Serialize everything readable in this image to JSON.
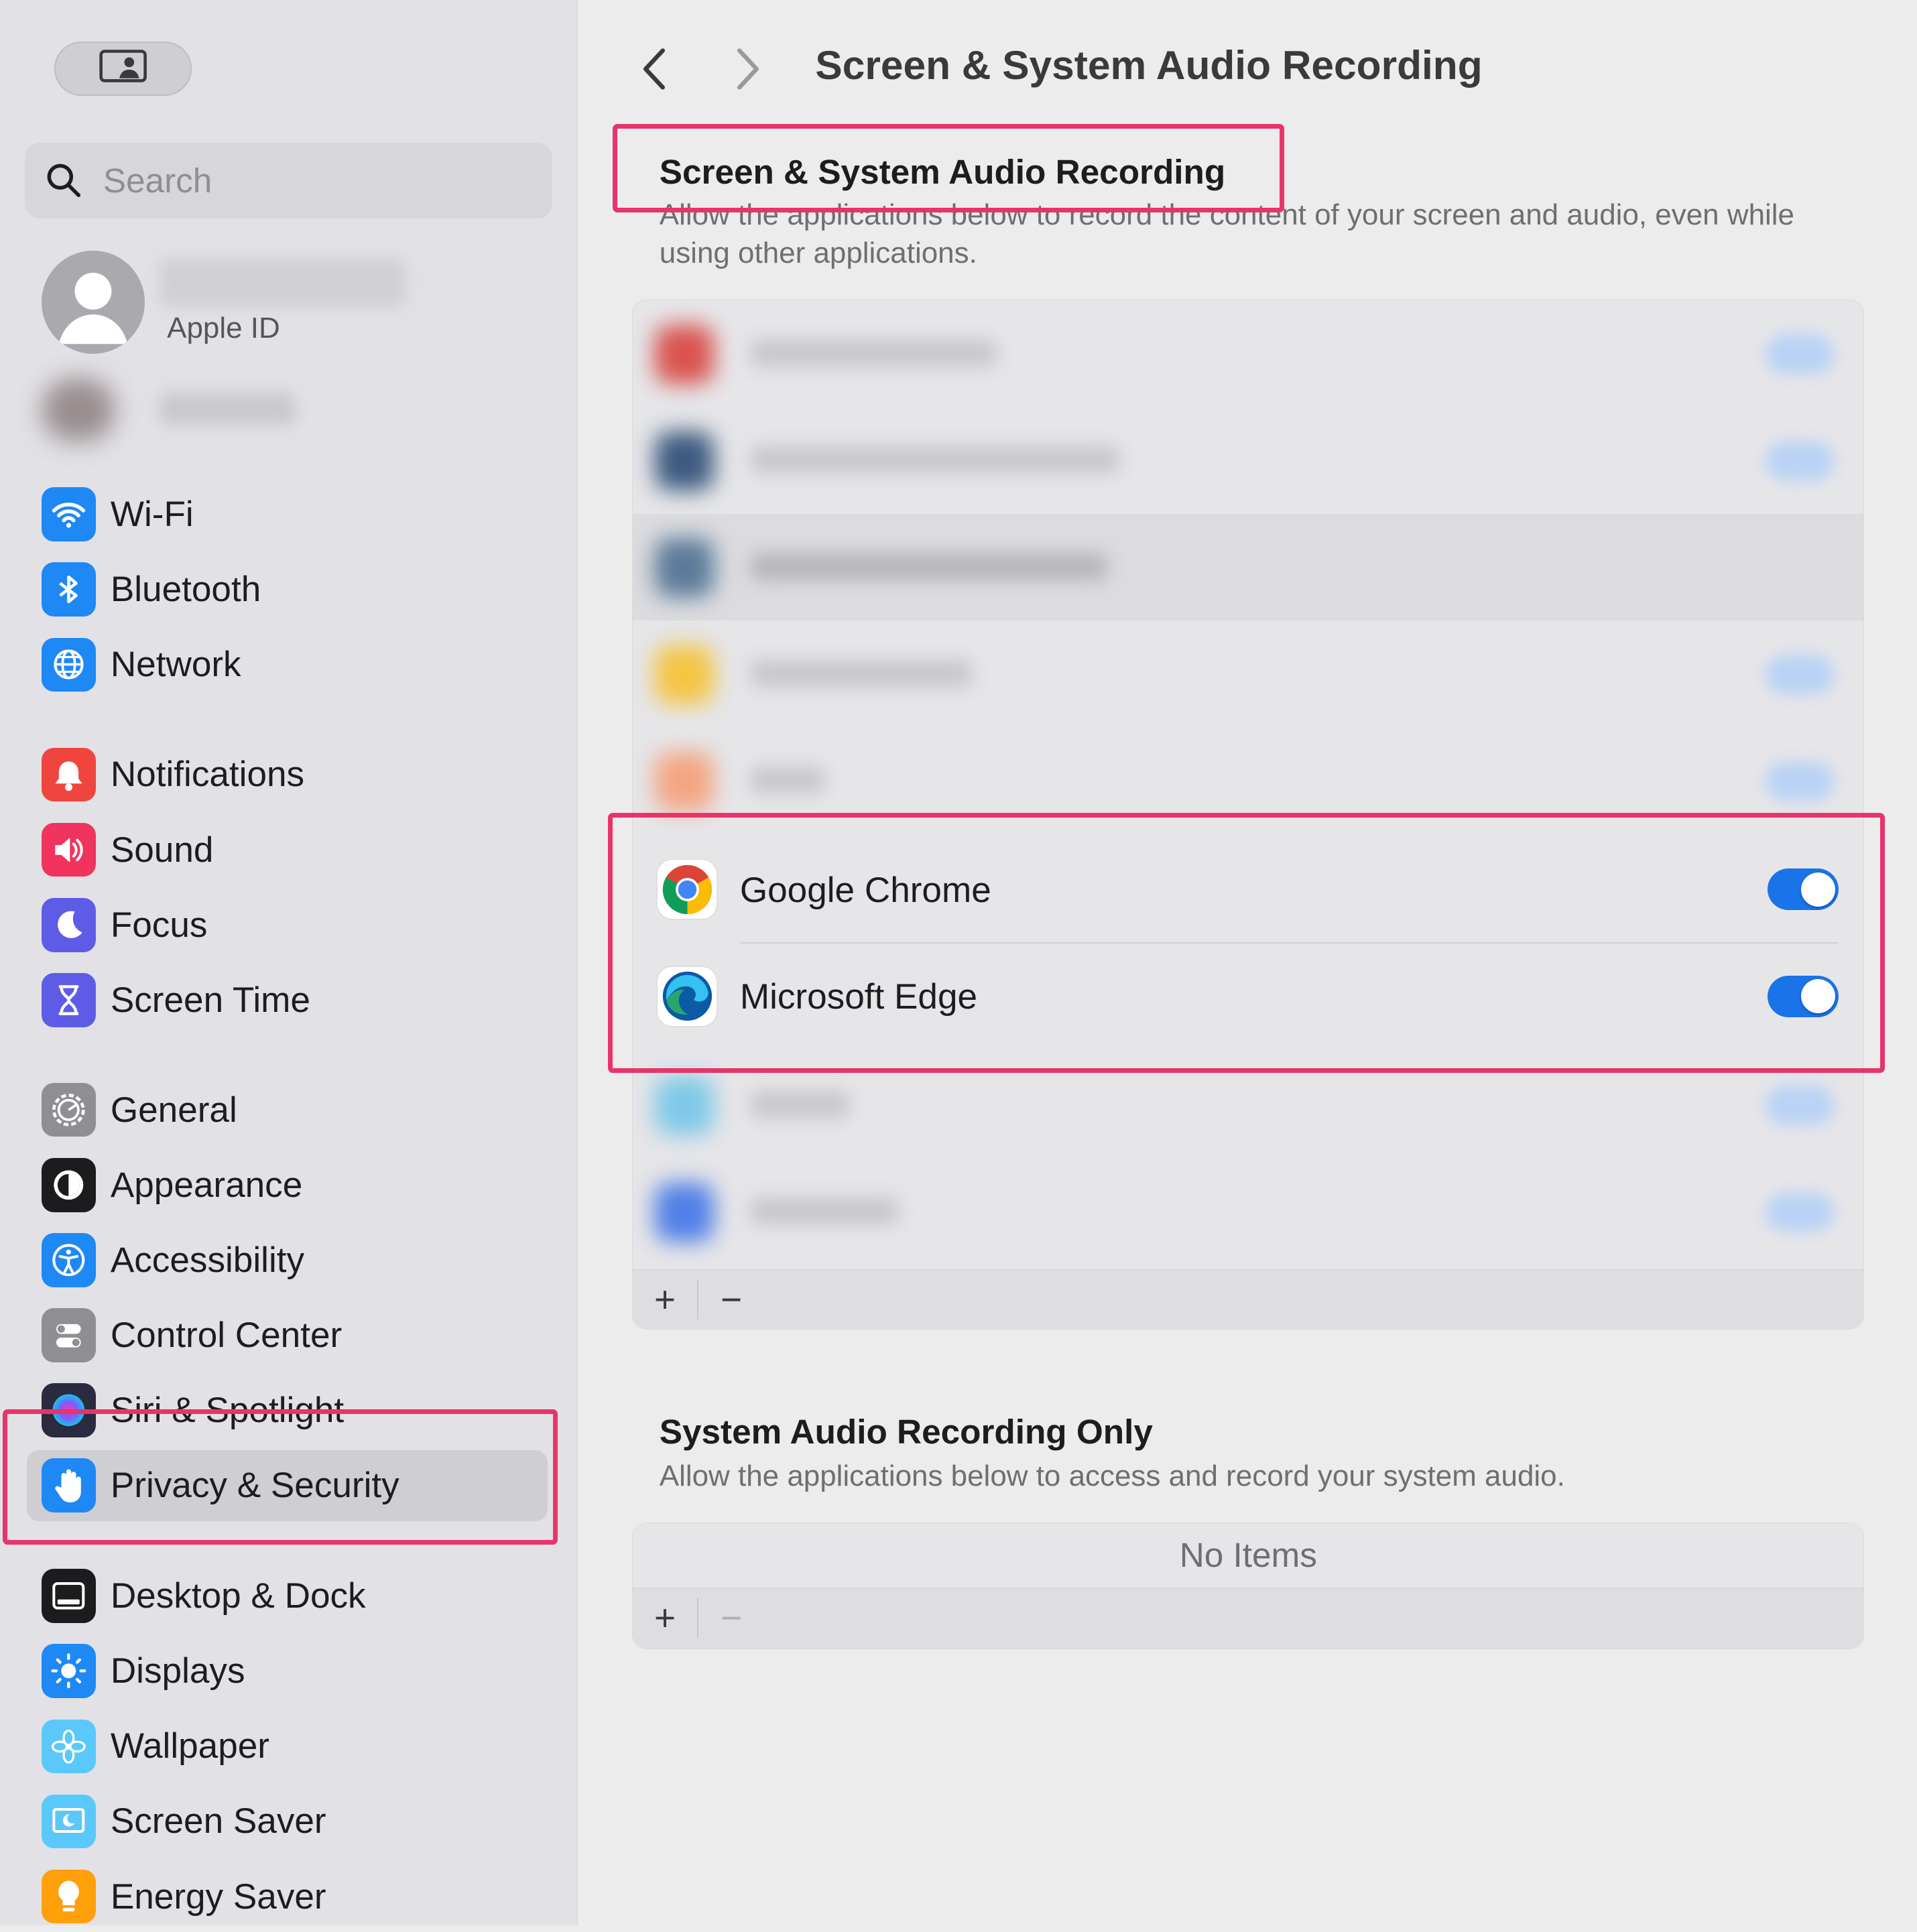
{
  "sidebar": {
    "search_placeholder": "Search",
    "account_label": "Apple ID",
    "groups": [
      [
        {
          "label": "Wi-Fi",
          "icon": "wifi-icon",
          "color": "#1E88F5"
        },
        {
          "label": "Bluetooth",
          "icon": "bluetooth-icon",
          "color": "#1E88F5"
        },
        {
          "label": "Network",
          "icon": "globe-icon",
          "color": "#1E88F5"
        }
      ],
      [
        {
          "label": "Notifications",
          "icon": "bell-icon",
          "color": "#F0453E"
        },
        {
          "label": "Sound",
          "icon": "speaker-icon",
          "color": "#F0345D"
        },
        {
          "label": "Focus",
          "icon": "moon-icon",
          "color": "#5E5CE6"
        },
        {
          "label": "Screen Time",
          "icon": "hourglass-icon",
          "color": "#5E5CE6"
        }
      ],
      [
        {
          "label": "General",
          "icon": "gear-icon",
          "color": "#8E8E93"
        },
        {
          "label": "Appearance",
          "icon": "appearance-icon",
          "color": "#1C1C1E"
        },
        {
          "label": "Accessibility",
          "icon": "accessibility-icon",
          "color": "#1E88F5"
        },
        {
          "label": "Control Center",
          "icon": "switches-icon",
          "color": "#8E8E93"
        },
        {
          "label": "Siri & Spotlight",
          "icon": "siri-icon",
          "color": "#2a2a40"
        },
        {
          "label": "Privacy & Security",
          "icon": "hand-icon",
          "color": "#1E88F5",
          "selected": true
        }
      ],
      [
        {
          "label": "Desktop & Dock",
          "icon": "dock-icon",
          "color": "#1C1C1E"
        },
        {
          "label": "Displays",
          "icon": "sun-icon",
          "color": "#1E88F5"
        },
        {
          "label": "Wallpaper",
          "icon": "flower-icon",
          "color": "#5AC8FA"
        },
        {
          "label": "Screen Saver",
          "icon": "screensaver-icon",
          "color": "#5AC8FA"
        },
        {
          "label": "Energy Saver",
          "icon": "bulb-icon",
          "color": "#FF9F0A"
        }
      ]
    ]
  },
  "header": {
    "title": "Screen & System Audio Recording"
  },
  "section1": {
    "title": "Screen & System Audio Recording",
    "description": "Allow the applications below to record the content of your screen and audio, even while using other applications.",
    "apps": [
      {
        "name": "Google Chrome",
        "icon": "chrome-icon",
        "enabled": true
      },
      {
        "name": "Microsoft Edge",
        "icon": "edge-icon",
        "enabled": true
      }
    ],
    "add_label": "+",
    "remove_label": "−"
  },
  "section2": {
    "title": "System Audio Recording Only",
    "description": "Allow the applications below to access and record your system audio.",
    "empty_label": "No Items",
    "add_label": "+",
    "remove_label": "−"
  },
  "colors": {
    "accent": "#1a73e8",
    "highlight": "#E8336B"
  }
}
